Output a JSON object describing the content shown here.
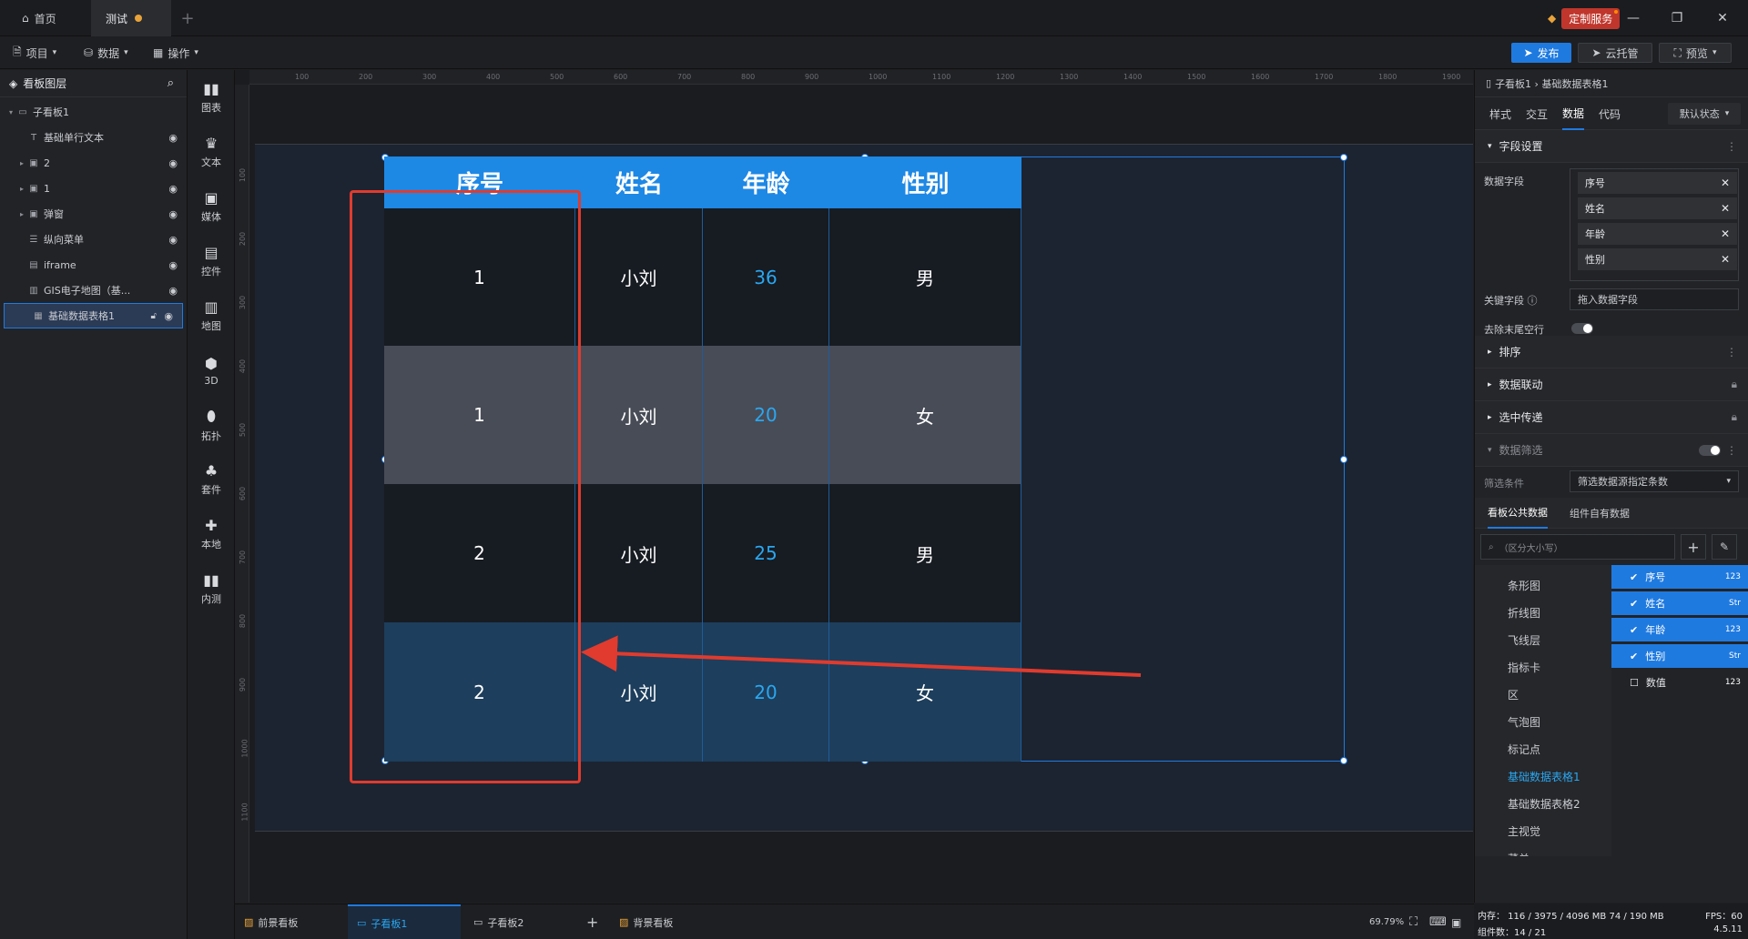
{
  "titlebar": {
    "tabs": [
      {
        "label": "首页"
      },
      {
        "label": "测试"
      }
    ],
    "custom_service": "定制服务"
  },
  "menubar": {
    "items": [
      {
        "label": "项目"
      },
      {
        "label": "数据"
      },
      {
        "label": "操作"
      }
    ],
    "publish": "发布",
    "cloud": "云托管",
    "preview": "预览"
  },
  "layers": {
    "title": "看板图层",
    "items": [
      {
        "label": "子看板1"
      },
      {
        "label": "基础单行文本"
      },
      {
        "label": "2"
      },
      {
        "label": "1"
      },
      {
        "label": "弹窗"
      },
      {
        "label": "纵向菜单"
      },
      {
        "label": "iframe"
      },
      {
        "label": "GIS电子地图（基..."
      },
      {
        "label": "基础数据表格1"
      }
    ]
  },
  "tools": [
    {
      "label": "图表"
    },
    {
      "label": "文本"
    },
    {
      "label": "媒体"
    },
    {
      "label": "控件"
    },
    {
      "label": "地图"
    },
    {
      "label": "3D"
    },
    {
      "label": "拓扑"
    },
    {
      "label": "套件"
    },
    {
      "label": "本地"
    },
    {
      "label": "内测"
    }
  ],
  "ruler": {
    "top": [
      "100",
      "200",
      "300",
      "400",
      "500",
      "600",
      "700",
      "800",
      "900",
      "1000",
      "1100",
      "1200",
      "1300",
      "1400",
      "1500",
      "1600",
      "1700",
      "1800",
      "1900"
    ],
    "left": [
      "100",
      "200",
      "300",
      "400",
      "500",
      "600",
      "700",
      "800",
      "900",
      "1000",
      "1100"
    ]
  },
  "table": {
    "headers": [
      "序号",
      "姓名",
      "年龄",
      "性别"
    ],
    "rows": [
      [
        "1",
        "小刘",
        "36",
        "男"
      ],
      [
        "1",
        "小刘",
        "20",
        "女"
      ],
      [
        "2",
        "小刘",
        "25",
        "男"
      ],
      [
        "2",
        "小刘",
        "20",
        "女"
      ]
    ]
  },
  "props": {
    "breadcrumb": "子看板1 › 基础数据表格1",
    "tabs": [
      {
        "label": "样式"
      },
      {
        "label": "交互"
      },
      {
        "label": "数据"
      },
      {
        "label": "代码"
      }
    ],
    "state": "默认状态",
    "field_settings": "字段设置",
    "data_fields_label": "数据字段",
    "data_fields": [
      "序号",
      "姓名",
      "年龄",
      "性别"
    ],
    "key_field_label": "关键字段",
    "key_field_placeholder": "拖入数据字段",
    "trim_label": "去除末尾空行",
    "sort": "排序",
    "linkage": "数据联动",
    "select_pass": "选中传递",
    "filter": "数据筛选",
    "filter_cond_label": "筛选条件",
    "filter_cond_value": "筛选数据源指定条数",
    "data_tabs": [
      {
        "label": "看板公共数据"
      },
      {
        "label": "组件自有数据"
      }
    ],
    "search_placeholder": "（区分大小写）",
    "components": [
      "条形图",
      "折线图",
      "飞线层",
      "指标卡",
      "区",
      "气泡图",
      "标记点",
      "基础数据表格1",
      "基础数据表格2",
      "主视觉",
      "菜单"
    ],
    "field_list": [
      {
        "name": "序号",
        "type": "123"
      },
      {
        "name": "姓名",
        "type": "Str"
      },
      {
        "name": "年龄",
        "type": "123"
      },
      {
        "name": "性别",
        "type": "Str"
      },
      {
        "name": "数值",
        "type": "123"
      }
    ]
  },
  "bottom": {
    "tabs": [
      {
        "label": "前景看板"
      },
      {
        "label": "子看板1"
      },
      {
        "label": "子看板2"
      },
      {
        "label": "背景看板"
      }
    ],
    "zoom": "69.79%"
  },
  "status": {
    "memory": "内存： 116 / 3975 / 4096 MB  74 / 190 MB",
    "fps": "FPS：60",
    "components": "组件数：14 / 21",
    "version": "4.5.11"
  },
  "colors": {
    "accent": "#1f7ae0",
    "header": "#1e88e5",
    "annotation": "#e03b2e",
    "age_text": "#2aa7f0"
  }
}
